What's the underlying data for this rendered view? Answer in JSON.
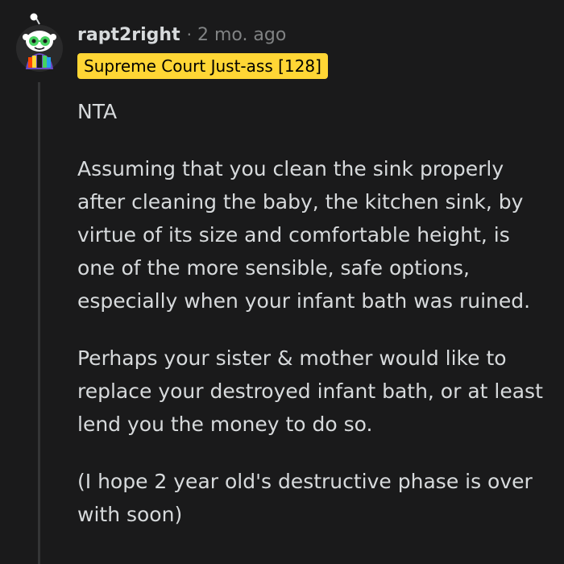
{
  "comment": {
    "author": "rapt2right",
    "separator": "·",
    "timestamp": "2 mo. ago",
    "flair": "Supreme Court Just-ass [128]",
    "avatar_icon": "snoo-avatar-icon",
    "paragraphs": [
      "NTA",
      "Assuming that you clean the sink properly after cleaning the baby, the kitchen sink, by virtue of its size and comfortable height, is one of the more sensible, safe options, especially when your infant bath was ruined.",
      "Perhaps your sister & mother would like to replace your destroyed infant bath, or at least lend you the money to do so.",
      "(I hope 2 year old's destructive phase is over with soon)"
    ]
  },
  "colors": {
    "background": "#1a1a1b",
    "text": "#d7dadc",
    "muted": "#818384",
    "flair_bg": "#ffd635",
    "flair_text": "#000000",
    "thread_line": "#343536"
  }
}
